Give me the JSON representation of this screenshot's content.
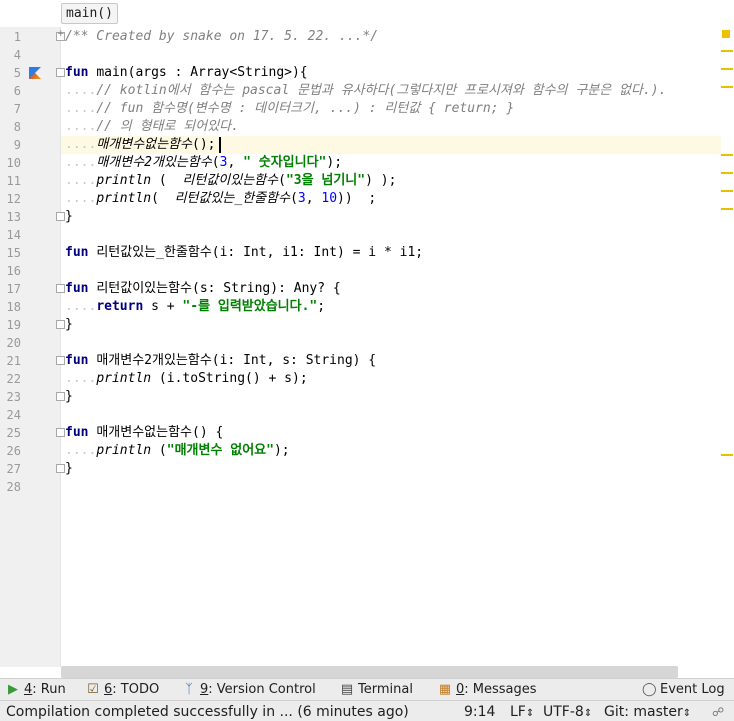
{
  "breadcrumb": {
    "label": "main()"
  },
  "colors": {
    "keyword": "#000080",
    "comment": "#808080",
    "string": "#008000",
    "number": "#0000ff",
    "caret_line": "#fdf9e3",
    "gutter": "#f0f0f0",
    "marker": "#e5c100"
  },
  "editor": {
    "lines": [
      {
        "num": "1",
        "fold": "plus",
        "tokens": [
          {
            "c": "cm",
            "t": "/** Created by snake on 17. 5. 22. ...*/"
          }
        ]
      },
      {
        "num": "4",
        "tokens": []
      },
      {
        "num": "5",
        "fold": "box",
        "icon": "kotlin-icon",
        "tokens": [
          {
            "c": "kw",
            "t": "fun "
          },
          {
            "c": "",
            "t": "main(args : Array<String>){"
          }
        ]
      },
      {
        "num": "6",
        "tokens": [
          {
            "c": "ws",
            "t": "...."
          },
          {
            "c": "cm",
            "t": "// kotlin에서 함수는 pascal 문법과 유사하다(그렇다지만 프로시져와 함수의 구분은 없다.)."
          }
        ]
      },
      {
        "num": "7",
        "tokens": [
          {
            "c": "ws",
            "t": "...."
          },
          {
            "c": "cm",
            "t": "// fun 함수명(변수명 : 데이터크기, ...) : 리턴값 { return; }"
          }
        ]
      },
      {
        "num": "8",
        "tokens": [
          {
            "c": "ws",
            "t": "...."
          },
          {
            "c": "cm",
            "t": "// 의 형태로 되어있다."
          }
        ]
      },
      {
        "num": "9",
        "current": true,
        "tokens": [
          {
            "c": "ws",
            "t": "...."
          },
          {
            "c": "it",
            "t": "매개변수없는함수"
          },
          {
            "c": "",
            "t": "();"
          }
        ]
      },
      {
        "num": "10",
        "tokens": [
          {
            "c": "ws",
            "t": "...."
          },
          {
            "c": "it",
            "t": "매개변수2개있는함수"
          },
          {
            "c": "",
            "t": "("
          },
          {
            "c": "num",
            "t": "3"
          },
          {
            "c": "",
            "t": ", "
          },
          {
            "c": "str",
            "t": "\" 숫자입니다\""
          },
          {
            "c": "",
            "t": ");"
          }
        ]
      },
      {
        "num": "11",
        "tokens": [
          {
            "c": "ws",
            "t": "...."
          },
          {
            "c": "it",
            "t": "println"
          },
          {
            "c": "",
            "t": " (  "
          },
          {
            "c": "it",
            "t": "리턴값이있는함수"
          },
          {
            "c": "",
            "t": "("
          },
          {
            "c": "str",
            "t": "\"3을 넘기니\""
          },
          {
            "c": "",
            "t": ") );"
          }
        ]
      },
      {
        "num": "12",
        "tokens": [
          {
            "c": "ws",
            "t": "...."
          },
          {
            "c": "it",
            "t": "println"
          },
          {
            "c": "",
            "t": "(  "
          },
          {
            "c": "it",
            "t": "리턴값있는_한줄함수"
          },
          {
            "c": "",
            "t": "("
          },
          {
            "c": "num",
            "t": "3"
          },
          {
            "c": "",
            "t": ", "
          },
          {
            "c": "num",
            "t": "10"
          },
          {
            "c": "",
            "t": "))  ;"
          }
        ]
      },
      {
        "num": "13",
        "fold": "box",
        "tokens": [
          {
            "c": "",
            "t": "}"
          }
        ]
      },
      {
        "num": "14",
        "tokens": []
      },
      {
        "num": "15",
        "tokens": [
          {
            "c": "kw",
            "t": "fun "
          },
          {
            "c": "",
            "t": "리턴값있는_한줄함수(i: Int, i1: Int) = i * i1;"
          }
        ]
      },
      {
        "num": "16",
        "tokens": []
      },
      {
        "num": "17",
        "fold": "box",
        "tokens": [
          {
            "c": "kw",
            "t": "fun "
          },
          {
            "c": "",
            "t": "리턴값이있는함수(s: String): Any? {"
          }
        ]
      },
      {
        "num": "18",
        "tokens": [
          {
            "c": "ws",
            "t": "...."
          },
          {
            "c": "kw",
            "t": "return "
          },
          {
            "c": "",
            "t": "s + "
          },
          {
            "c": "str",
            "t": "\"-를 입력받았습니다.\""
          },
          {
            "c": "",
            "t": ";"
          }
        ]
      },
      {
        "num": "19",
        "fold": "box",
        "tokens": [
          {
            "c": "",
            "t": "}"
          }
        ]
      },
      {
        "num": "20",
        "tokens": []
      },
      {
        "num": "21",
        "fold": "box",
        "tokens": [
          {
            "c": "kw",
            "t": "fun "
          },
          {
            "c": "",
            "t": "매개변수2개있는함수(i: Int, s: String) {"
          }
        ]
      },
      {
        "num": "22",
        "tokens": [
          {
            "c": "ws",
            "t": "...."
          },
          {
            "c": "it",
            "t": "println"
          },
          {
            "c": "",
            "t": " (i.toString() + s);"
          }
        ]
      },
      {
        "num": "23",
        "fold": "box",
        "tokens": [
          {
            "c": "",
            "t": "}"
          }
        ]
      },
      {
        "num": "24",
        "tokens": []
      },
      {
        "num": "25",
        "fold": "box",
        "tokens": [
          {
            "c": "kw",
            "t": "fun "
          },
          {
            "c": "",
            "t": "매개변수없는함수() {"
          }
        ]
      },
      {
        "num": "26",
        "tokens": [
          {
            "c": "ws",
            "t": "...."
          },
          {
            "c": "it",
            "t": "println"
          },
          {
            "c": "",
            "t": " ("
          },
          {
            "c": "str",
            "t": "\"매개변수 없어요\""
          },
          {
            "c": "",
            "t": ");"
          }
        ]
      },
      {
        "num": "27",
        "fold": "box",
        "tokens": [
          {
            "c": "",
            "t": "}"
          }
        ]
      },
      {
        "num": "28",
        "tokens": []
      }
    ]
  },
  "toolwindows": {
    "run": {
      "num": "4",
      "label": ": Run",
      "icon": "run-icon"
    },
    "todo": {
      "num": "6",
      "label": ": TODO",
      "icon": "todo-icon"
    },
    "vcs": {
      "num": "9",
      "label": ": Version Control",
      "icon": "vcs-icon"
    },
    "terminal": {
      "label": "Terminal",
      "icon": "terminal-icon"
    },
    "messages": {
      "num": "0",
      "label": ": Messages",
      "icon": "messages-icon"
    },
    "eventlog": {
      "label": "Event Log",
      "icon": "event-log-icon"
    }
  },
  "statusbar": {
    "message": "Compilation completed successfully in ... (6 minutes ago)",
    "position": "9:14",
    "line_sep": "LF",
    "encoding": "UTF-8",
    "vcs": "Git: master"
  }
}
